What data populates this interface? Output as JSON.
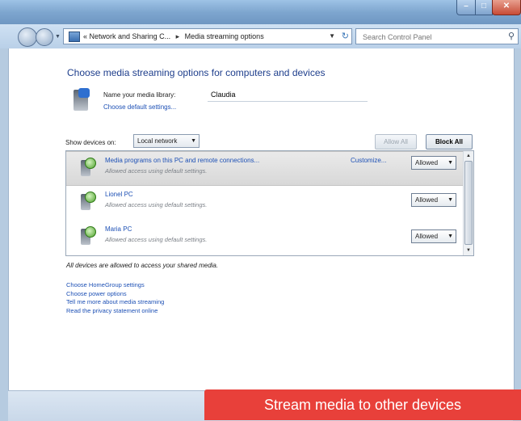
{
  "window": {
    "controls": {
      "minimize": "–",
      "maximize": "□",
      "close": "✕"
    }
  },
  "nav": {
    "back_icon": "back-arrow-icon",
    "forward_icon": "forward-arrow-icon",
    "breadcrumb_prefix": "«",
    "breadcrumb": [
      "Network and Sharing C...",
      "Media streaming options"
    ],
    "breadcrumb_sep": "▸",
    "search_placeholder": "Search Control Panel"
  },
  "page": {
    "heading": "Choose media streaming options for computers and devices",
    "library_label": "Name your media library:",
    "library_value": "Claudia",
    "default_settings_link": "Choose default settings...",
    "show_devices_label": "Show devices on:",
    "show_devices_value": "Local network",
    "allow_all": "Allow All",
    "block_all": "Block All"
  },
  "devices": [
    {
      "name": "Media programs on this PC and remote connections...",
      "subtitle": "Allowed access using default settings.",
      "customize": "Customize...",
      "status": "Allowed"
    },
    {
      "name": "Lionel PC",
      "subtitle": "Allowed access using default settings.",
      "status": "Allowed"
    },
    {
      "name": "Maria PC",
      "subtitle": "Allowed access using default settings.",
      "status": "Allowed"
    }
  ],
  "footer_note": "All devices are allowed to access your shared media.",
  "links": [
    "Choose HomeGroup settings",
    "Choose power options",
    "Tell me more about media streaming",
    "Read the privacy statement online"
  ],
  "caption": "Stream media to other devices",
  "colors": {
    "link": "#1d50b5",
    "heading": "#1e3e8c",
    "caption_bg": "#e8403a"
  }
}
